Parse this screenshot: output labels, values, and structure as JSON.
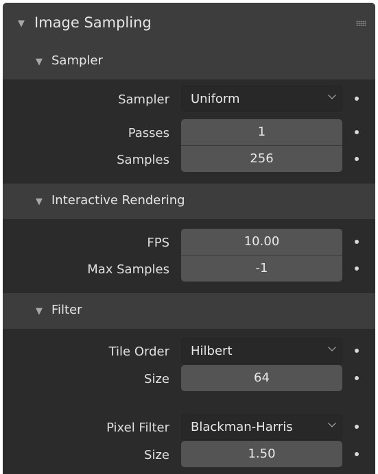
{
  "panel": {
    "title": "Image Sampling",
    "collapse_icon": "triangle-down-icon",
    "drag_icon": "grip-dots-icon"
  },
  "sampler_section": {
    "title": "Sampler",
    "sampler_label": "Sampler",
    "sampler_value": "Uniform",
    "passes_label": "Passes",
    "passes_value": "1",
    "samples_label": "Samples",
    "samples_value": "256"
  },
  "interactive_section": {
    "title": "Interactive Rendering",
    "fps_label": "FPS",
    "fps_value": "10.00",
    "max_samples_label": "Max Samples",
    "max_samples_value": "-1"
  },
  "filter_section": {
    "title": "Filter",
    "tile_order_label": "Tile Order",
    "tile_order_value": "Hilbert",
    "tile_size_label": "Size",
    "tile_size_value": "64",
    "pixel_filter_label": "Pixel Filter",
    "pixel_filter_value": "Blackman-Harris",
    "filter_size_label": "Size",
    "filter_size_value": "1.50"
  },
  "colors": {
    "panel_bg": "#303030",
    "header_bg": "#3d3d3d",
    "field_bg": "#545454",
    "dropdown_bg": "#282828",
    "text": "#e6e6e6"
  }
}
